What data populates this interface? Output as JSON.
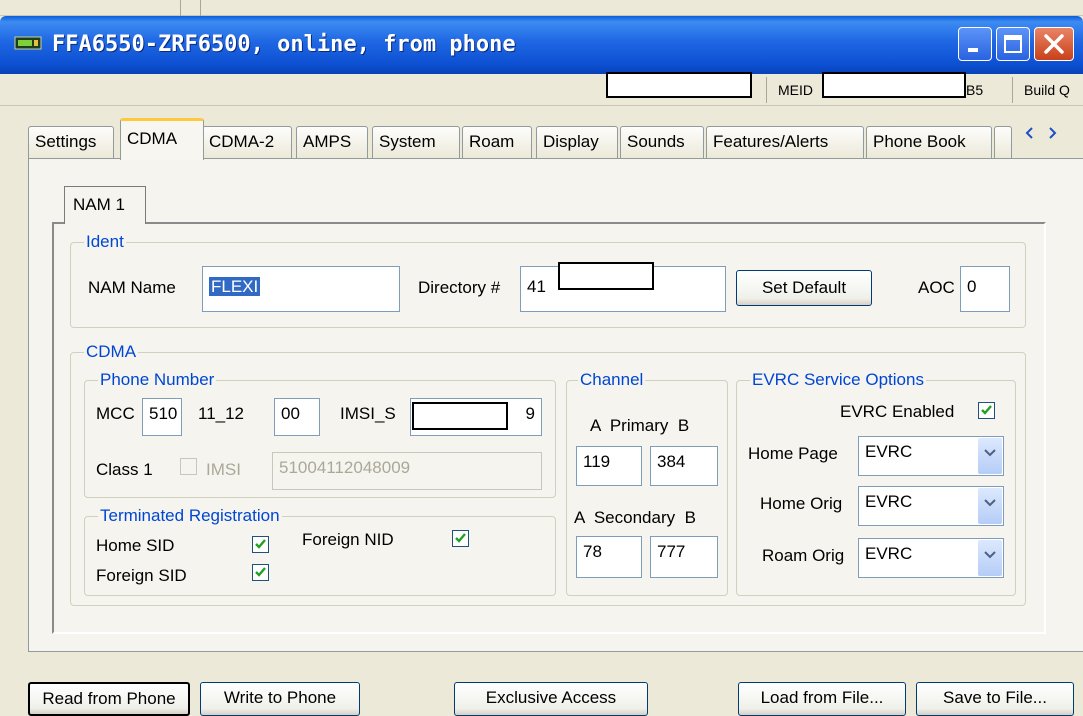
{
  "window": {
    "title": "FFA6550-ZRF6500, online, from phone"
  },
  "status_bar": {
    "meid_label": "MEID",
    "meid_suffix": "B5",
    "build_label": "Build Q"
  },
  "tabs": [
    {
      "label": "Settings"
    },
    {
      "label": "CDMA"
    },
    {
      "label": "CDMA-2"
    },
    {
      "label": "AMPS"
    },
    {
      "label": "System"
    },
    {
      "label": "Roam"
    },
    {
      "label": "Display"
    },
    {
      "label": "Sounds"
    },
    {
      "label": "Features/Alerts"
    },
    {
      "label": "Phone Book"
    }
  ],
  "nam_tab": {
    "label": "NAM 1"
  },
  "ident": {
    "legend": "Ident",
    "nam_name_label": "NAM Name",
    "nam_name_value": "FLEXI",
    "directory_label": "Directory #",
    "directory_value": "41",
    "set_default_label": "Set Default",
    "aoc_label": "AOC",
    "aoc_value": "0"
  },
  "cdma": {
    "legend": "CDMA",
    "phone_number": {
      "legend": "Phone Number",
      "mcc_label": "MCC",
      "mcc_value": "510",
      "p11_12_label": "11_12",
      "p11_12_value": "00",
      "imsi_s_label": "IMSI_S",
      "imsi_s_suffix": "9",
      "class1_label": "Class 1",
      "imsi_label": "IMSI",
      "imsi_value": "51004112048009"
    },
    "terminated_registration": {
      "legend": "Terminated Registration",
      "home_sid_label": "Home SID",
      "foreign_sid_label": "Foreign SID",
      "foreign_nid_label": "Foreign NID"
    },
    "channel": {
      "legend": "Channel",
      "primary_label": "A  Primary  B",
      "primary_a": "119",
      "primary_b": "384",
      "secondary_label": "A  Secondary  B",
      "secondary_a": "78",
      "secondary_b": "777"
    },
    "evrc": {
      "legend": "EVRC Service Options",
      "enabled_label": "EVRC Enabled",
      "home_page_label": "Home Page",
      "home_page_value": "EVRC",
      "home_orig_label": "Home Orig",
      "home_orig_value": "EVRC",
      "roam_orig_label": "Roam Orig",
      "roam_orig_value": "EVRC"
    }
  },
  "footer": {
    "read_label": "Read from Phone",
    "write_label": "Write to Phone",
    "exclusive_label": "Exclusive Access",
    "load_label": "Load from File...",
    "save_label": "Save to File..."
  },
  "colors": {
    "title_bar": "#1e66e3",
    "legend_text": "#0046d5",
    "active_tab_highlight": "#ffc83d",
    "check_mark": "#21a121"
  }
}
